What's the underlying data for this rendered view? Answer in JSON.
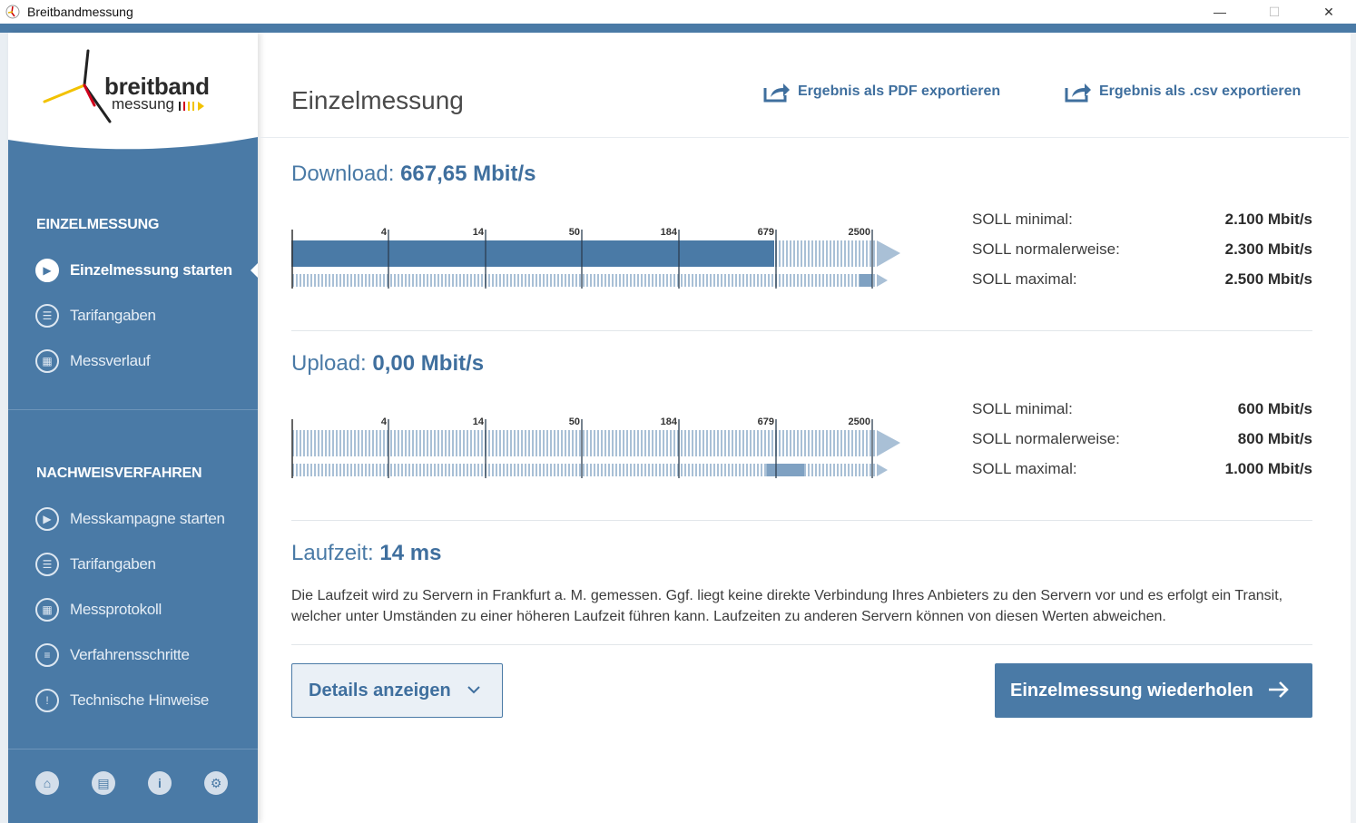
{
  "window": {
    "title": "Breitbandmessung",
    "minimize": "—",
    "maximize": "☐",
    "close": "✕"
  },
  "logo": {
    "line1": "breitband",
    "line2": "messung"
  },
  "sidebar": {
    "section1": "EINZELMESSUNG",
    "items1": [
      {
        "label": "Einzelmessung starten",
        "icon": "play-icon",
        "active": true
      },
      {
        "label": "Tarifangaben",
        "icon": "user-list-icon",
        "active": false
      },
      {
        "label": "Messverlauf",
        "icon": "calendar-icon",
        "active": false
      }
    ],
    "section2": "NACHWEISVERFAHREN",
    "items2": [
      {
        "label": "Messkampagne starten",
        "icon": "play-icon"
      },
      {
        "label": "Tarifangaben",
        "icon": "user-list-icon"
      },
      {
        "label": "Messprotokoll",
        "icon": "calendar-icon"
      },
      {
        "label": "Verfahrensschritte",
        "icon": "list-icon"
      },
      {
        "label": "Technische Hinweise",
        "icon": "warning-icon"
      }
    ],
    "footer_icons": [
      "home-icon",
      "chat-icon",
      "info-icon",
      "gear-icon"
    ]
  },
  "header": {
    "title": "Einzelmessung",
    "export_pdf": "Ergebnis als PDF exportieren",
    "export_csv": "Ergebnis als .csv exportieren"
  },
  "download": {
    "label": "Download:",
    "value": "667,65 Mbit/s",
    "measured": 667.65,
    "scale_ticks": [
      "4",
      "14",
      "50",
      "184",
      "679",
      "2500"
    ],
    "soll": [
      {
        "k": "SOLL minimal:",
        "v": "2.100 Mbit/s"
      },
      {
        "k": "SOLL normalerweise:",
        "v": "2.300 Mbit/s"
      },
      {
        "k": "SOLL maximal:",
        "v": "2.500 Mbit/s"
      }
    ]
  },
  "upload": {
    "label": "Upload:",
    "value": "0,00 Mbit/s",
    "measured": 0,
    "scale_ticks": [
      "4",
      "14",
      "50",
      "184",
      "679",
      "2500"
    ],
    "soll": [
      {
        "k": "SOLL minimal:",
        "v": "600 Mbit/s"
      },
      {
        "k": "SOLL normalerweise:",
        "v": "800 Mbit/s"
      },
      {
        "k": "SOLL maximal:",
        "v": "1.000 Mbit/s"
      }
    ]
  },
  "latency": {
    "label": "Laufzeit:",
    "value": "14 ms",
    "description": "Die Laufzeit wird zu Servern in Frankfurt a. M. gemessen. Ggf. liegt keine direkte Verbindung Ihres Anbieters zu den Servern vor und es erfolgt ein Transit, welcher unter Umständen zu einer höheren Laufzeit führen kann. Laufzeiten zu anderen Servern können von diesen Werten abweichen."
  },
  "buttons": {
    "details": "Details anzeigen",
    "repeat": "Einzelmessung wiederholen"
  },
  "colors": {
    "primary": "#4a7aa6",
    "sidebar": "#4a7aa6",
    "stripe": "#a9c0d6"
  }
}
